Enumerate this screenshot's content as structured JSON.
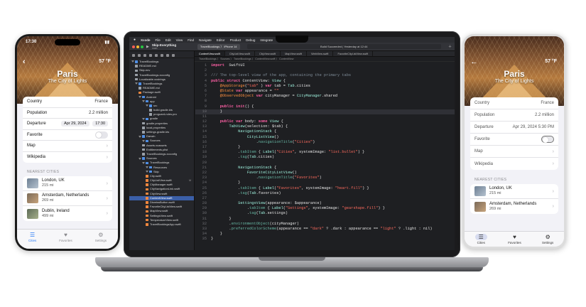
{
  "laptop": {
    "menubar": [
      "Xcode",
      "File",
      "Edit",
      "View",
      "Find",
      "Navigate",
      "Editor",
      "Product",
      "Debug",
      "Integrate"
    ],
    "project": "Skip-Everything",
    "project_sub": "main",
    "scheme": "TravelBookings  〉 iPhone 14",
    "status": "Build Succeeded | Yesterday at 12:44",
    "tabs": [
      "ContentView.swift",
      "CityListView.swift",
      "CityView.swift",
      "MapView.swift",
      "WebView.swift",
      "FavoriteCityListView.swift"
    ],
    "breadcrumb": "TravelBookings 〉 Sources 〉 TravelBookings 〉 ContentView.swift 〉 ContentView",
    "navigator": [
      {
        "t": "TravelBookings",
        "k": "folder",
        "d": 0
      },
      {
        "t": "README.md",
        "k": "file",
        "d": 1
      },
      {
        "t": "Skip.env",
        "k": "file",
        "d": 1
      },
      {
        "t": "TravelBookings.xcconfig",
        "k": "file",
        "d": 1
      },
      {
        "t": "Localizable.xcstrings",
        "k": "file",
        "d": 1
      },
      {
        "t": "TravelBookings",
        "k": "folder",
        "d": 1
      },
      {
        "t": "README.md",
        "k": "file",
        "d": 2
      },
      {
        "t": "Package.swift",
        "k": "swift",
        "d": 2
      },
      {
        "t": "Android",
        "k": "folder",
        "d": 2
      },
      {
        "t": "app",
        "k": "folder",
        "d": 3
      },
      {
        "t": "src",
        "k": "folder",
        "d": 4
      },
      {
        "t": "build.gradle.kts",
        "k": "file",
        "d": 5
      },
      {
        "t": "proguard-rules.pro",
        "k": "file",
        "d": 5
      },
      {
        "t": "gradle",
        "k": "folder",
        "d": 3
      },
      {
        "t": "gradle.properties",
        "k": "file",
        "d": 3
      },
      {
        "t": "local.properties",
        "k": "file",
        "d": 3
      },
      {
        "t": "settings.gradle.kts",
        "k": "file",
        "d": 3
      },
      {
        "t": "Darwin",
        "k": "folder",
        "d": 2
      },
      {
        "t": "Sources",
        "k": "folder",
        "d": 3
      },
      {
        "t": "Assets.xcassets",
        "k": "file",
        "d": 3
      },
      {
        "t": "Entitlements.plist",
        "k": "file",
        "d": 3
      },
      {
        "t": "TravelBookings.xcconfig",
        "k": "file",
        "d": 3
      },
      {
        "t": "Sources",
        "k": "folder",
        "d": 2
      },
      {
        "t": "TravelBookings",
        "k": "folder",
        "d": 3
      },
      {
        "t": "Resources",
        "k": "folder",
        "d": 4
      },
      {
        "t": "Skip",
        "k": "folder",
        "d": 4
      },
      {
        "t": "City.swift",
        "k": "swift",
        "d": 4
      },
      {
        "t": "CityListView.swift",
        "k": "swift",
        "d": 4,
        "b": "M"
      },
      {
        "t": "CityManager.swift",
        "k": "swift",
        "d": 4
      },
      {
        "t": "CityNavigationLink.swift",
        "k": "swift",
        "d": 4
      },
      {
        "t": "CityView.swift",
        "k": "swift",
        "d": 4
      },
      {
        "t": "ContentView.swift",
        "k": "swift",
        "d": 4,
        "sel": true
      },
      {
        "t": "DismissButton.swift",
        "k": "swift",
        "d": 4
      },
      {
        "t": "FavoriteCityListView.swift",
        "k": "swift",
        "d": 4
      },
      {
        "t": "MapView.swift",
        "k": "swift",
        "d": 4
      },
      {
        "t": "SettingsView.swift",
        "k": "swift",
        "d": 4
      },
      {
        "t": "TemperatureView.swift",
        "k": "swift",
        "d": 4
      },
      {
        "t": "TravelBookingsApp.swift",
        "k": "swift",
        "d": 4
      }
    ],
    "code": [
      [
        [
          "kw",
          "import"
        ],
        [
          "",
          "  SwiftUI"
        ]
      ],
      [],
      [
        [
          "cm",
          "/// The top-level view of the app, containing the primary tabs"
        ]
      ],
      [
        [
          "kw",
          "public struct"
        ],
        [
          "",
          " ContentView: "
        ],
        [
          "ty",
          "View"
        ],
        [
          "",
          " {"
        ]
      ],
      [
        [
          "",
          "    "
        ],
        [
          "at",
          "@AppStorage"
        ],
        [
          "",
          "("
        ],
        [
          "st",
          "\"tab\""
        ],
        [
          "",
          " ) "
        ],
        [
          "kw",
          "var"
        ],
        [
          "",
          " tab = "
        ],
        [
          "ty",
          "Tab"
        ],
        [
          "",
          ".cities"
        ]
      ],
      [
        [
          "",
          "    "
        ],
        [
          "at",
          "@State"
        ],
        [
          "",
          " "
        ],
        [
          "kw",
          "var"
        ],
        [
          "",
          " appearance = "
        ],
        [
          "st",
          "\"\""
        ]
      ],
      [
        [
          "",
          "    "
        ],
        [
          "at",
          "@ObservedObject"
        ],
        [
          "",
          " "
        ],
        [
          "kw",
          "var"
        ],
        [
          "",
          " cityManager = "
        ],
        [
          "ty",
          "CityManager"
        ],
        [
          "",
          ".shared"
        ]
      ],
      [],
      [
        [
          "",
          "    "
        ],
        [
          "kw",
          "public init"
        ],
        [
          "",
          "() {"
        ]
      ],
      [
        [
          "",
          "    }"
        ]
      ],
      [],
      [
        [
          "",
          "    "
        ],
        [
          "kw",
          "public var"
        ],
        [
          "",
          " body: "
        ],
        [
          "kw",
          "some"
        ],
        [
          "",
          " "
        ],
        [
          "ty",
          "View"
        ],
        [
          "",
          " {"
        ]
      ],
      [
        [
          "",
          "        "
        ],
        [
          "ty",
          "TabView"
        ],
        [
          "",
          "(selection: $tab) {"
        ]
      ],
      [
        [
          "",
          "            "
        ],
        [
          "ty",
          "NavigationStack"
        ],
        [
          "",
          " {"
        ]
      ],
      [
        [
          "",
          "                "
        ],
        [
          "ty",
          "CityListView"
        ],
        [
          "",
          "()"
        ]
      ],
      [
        [
          "",
          "                    ."
        ],
        [
          "fn",
          "navigationTitle"
        ],
        [
          "",
          "("
        ],
        [
          "st",
          "\"Cities\""
        ],
        [
          "",
          ")"
        ]
      ],
      [
        [
          "",
          "            }"
        ]
      ],
      [
        [
          "",
          "            ."
        ],
        [
          "fn",
          "tabItem"
        ],
        [
          "",
          " { "
        ],
        [
          "ty",
          "Label"
        ],
        [
          "",
          "("
        ],
        [
          "st",
          "\"Cities\""
        ],
        [
          "",
          ", systemImage: "
        ],
        [
          "st",
          "\"list.bullet\""
        ],
        [
          "",
          ") }"
        ]
      ],
      [
        [
          "",
          "            ."
        ],
        [
          "fn",
          "tag"
        ],
        [
          "",
          "("
        ],
        [
          "ty",
          "Tab"
        ],
        [
          "",
          ".cities)"
        ]
      ],
      [],
      [
        [
          "",
          "            "
        ],
        [
          "ty",
          "NavigationStack"
        ],
        [
          "",
          " {"
        ]
      ],
      [
        [
          "",
          "                "
        ],
        [
          "ty",
          "FavoriteCityListView"
        ],
        [
          "",
          "()"
        ]
      ],
      [
        [
          "",
          "                    ."
        ],
        [
          "fn",
          "navigationTitle"
        ],
        [
          "",
          "("
        ],
        [
          "st",
          "\"Favorites\""
        ],
        [
          "",
          ")"
        ]
      ],
      [
        [
          "",
          "            }"
        ]
      ],
      [
        [
          "",
          "            ."
        ],
        [
          "fn",
          "tabItem"
        ],
        [
          "",
          " { "
        ],
        [
          "ty",
          "Label"
        ],
        [
          "",
          "("
        ],
        [
          "st",
          "\"Favorites\""
        ],
        [
          "",
          ", systemImage: "
        ],
        [
          "st",
          "\"heart.fill\""
        ],
        [
          "",
          ") }"
        ]
      ],
      [
        [
          "",
          "            ."
        ],
        [
          "fn",
          "tag"
        ],
        [
          "",
          "("
        ],
        [
          "ty",
          "Tab"
        ],
        [
          "",
          ".favorites)"
        ]
      ],
      [],
      [
        [
          "",
          "            "
        ],
        [
          "ty",
          "SettingsView"
        ],
        [
          "",
          "(appearance: $appearance)"
        ]
      ],
      [
        [
          "",
          "                ."
        ],
        [
          "fn",
          "tabItem"
        ],
        [
          "",
          " { "
        ],
        [
          "ty",
          "Label"
        ],
        [
          "",
          "("
        ],
        [
          "st",
          "\"Settings\""
        ],
        [
          "",
          ", systemImage: "
        ],
        [
          "st",
          "\"gearshape.fill\""
        ],
        [
          "",
          ") }"
        ]
      ],
      [
        [
          "",
          "                ."
        ],
        [
          "fn",
          "tag"
        ],
        [
          "",
          "("
        ],
        [
          "ty",
          "Tab"
        ],
        [
          "",
          ".settings)"
        ]
      ],
      [
        [
          "",
          "        }"
        ]
      ],
      [
        [
          "",
          "        ."
        ],
        [
          "fn",
          "environmentObject"
        ],
        [
          "",
          "(cityManager)"
        ]
      ],
      [
        [
          "",
          "        ."
        ],
        [
          "fn",
          "preferredColorScheme"
        ],
        [
          "",
          "(appearance == "
        ],
        [
          "st",
          "\"dark\""
        ],
        [
          "",
          " ? .dark : appearance == "
        ],
        [
          "st",
          "\"light\""
        ],
        [
          "",
          " ? .light : nil)"
        ]
      ],
      [
        [
          "",
          "    }"
        ]
      ],
      [
        [
          "",
          "}"
        ]
      ]
    ],
    "current_line": 10
  },
  "phone_left": {
    "time": "17:30",
    "temp": "57 °F",
    "city": "Paris",
    "subtitle": "The City of Lights",
    "rows": {
      "country_label": "Country",
      "country": "France",
      "population_label": "Population",
      "population": "2.2 million",
      "departure_label": "Departure",
      "date": "Apr 29, 2024",
      "time": "17:30",
      "favorite_label": "Favorite",
      "map_label": "Map",
      "wikipedia_label": "Wikipedia"
    },
    "nearest_label": "NEAREST CITIES",
    "nearest": [
      {
        "name": "London, UK",
        "dist": "215 mi"
      },
      {
        "name": "Amsterdam, Netherlands",
        "dist": "269 mi"
      },
      {
        "name": "Dublin, Ireland",
        "dist": "499 mi"
      }
    ],
    "tabs": [
      "Cities",
      "Favorites",
      "Settings"
    ]
  },
  "phone_right": {
    "temp": "57 °F",
    "city": "Paris",
    "subtitle": "The City of Lights",
    "rows": {
      "country_label": "Country",
      "country": "France",
      "population_label": "Population",
      "population": "2.2 million",
      "departure_label": "Departure",
      "departure": "Apr 29, 2024   5:30 PM",
      "favorite_label": "Favorite",
      "map_label": "Map",
      "wikipedia_label": "Wikipedia"
    },
    "nearest_label": "NEAREST CITIES",
    "nearest": [
      {
        "name": "London, UK",
        "dist": "215 mi"
      },
      {
        "name": "Amsterdam, Netherlands",
        "dist": "269 mi"
      }
    ],
    "tabs": [
      "Cities",
      "Favorites",
      "Settings"
    ]
  }
}
